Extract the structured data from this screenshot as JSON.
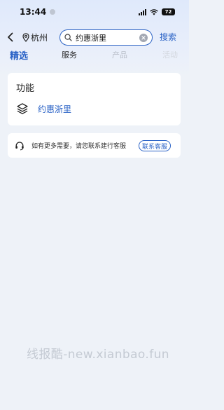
{
  "status_bar": {
    "time": "13:44",
    "battery": "72"
  },
  "header": {
    "city": "杭州",
    "search": {
      "value": "约惠浙里"
    },
    "search_button": "搜索"
  },
  "tabs": [
    {
      "label": "精选"
    },
    {
      "label": "服务"
    },
    {
      "label": "产品"
    },
    {
      "label": "活动"
    }
  ],
  "feature_section": {
    "title": "功能",
    "item_label": "约惠浙里"
  },
  "help": {
    "text": "如有更多需要，请您联系建行客服",
    "button": "联系客服"
  },
  "watermark": "线报酷-new.xianbao.fun",
  "colors": {
    "accent": "#2a62c6",
    "background": "#eef2f8"
  }
}
